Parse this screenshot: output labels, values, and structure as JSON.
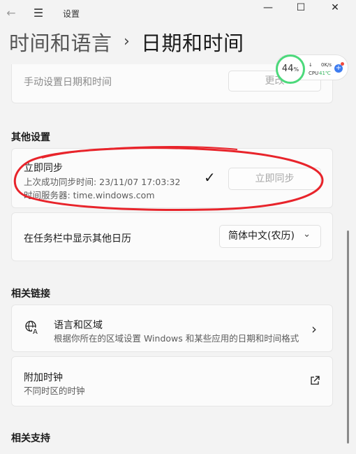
{
  "titlebar": {
    "back_icon": "←",
    "menu_icon": "☰",
    "app_title": "设置",
    "minimize_icon": "—",
    "maximize_icon": "☐",
    "close_icon": "✕"
  },
  "breadcrumb": {
    "parent": "时间和语言",
    "separator": "›",
    "current": "日期和时间"
  },
  "manual_time": {
    "label": "手动设置日期和时间",
    "button": "更改"
  },
  "other_settings": {
    "heading": "其他设置",
    "sync": {
      "title": "立即同步",
      "last_sync": "上次成功同步时间: 23/11/07 17:03:32",
      "server": "时间服务器: time.windows.com",
      "check_icon": "✓",
      "button": "立即同步"
    },
    "calendar": {
      "label": "在任务栏中显示其他日历",
      "selected": "简体中文(农历)",
      "chevron": "⌄"
    }
  },
  "related_links": {
    "heading": "相关链接",
    "language_region": {
      "title": "语言和区域",
      "desc": "根据你所在的区域设置 Windows 和某些应用的日期和时间格式",
      "chevron": "›"
    },
    "extra_clock": {
      "title": "附加时钟",
      "desc": "不同时区的时钟",
      "external_icon": "⧉"
    }
  },
  "related_support": {
    "heading": "相关支持"
  },
  "widget": {
    "percent": "44",
    "percent_unit": "%",
    "net": "0K/s",
    "cpu_label": "CPU",
    "cpu_temp": "41℃",
    "plus": "+",
    "percent_value": 0.44
  },
  "colors": {
    "annotation_red": "#e8242b",
    "ring_green": "#4cd97b",
    "accent_blue": "#3d7cf0"
  }
}
